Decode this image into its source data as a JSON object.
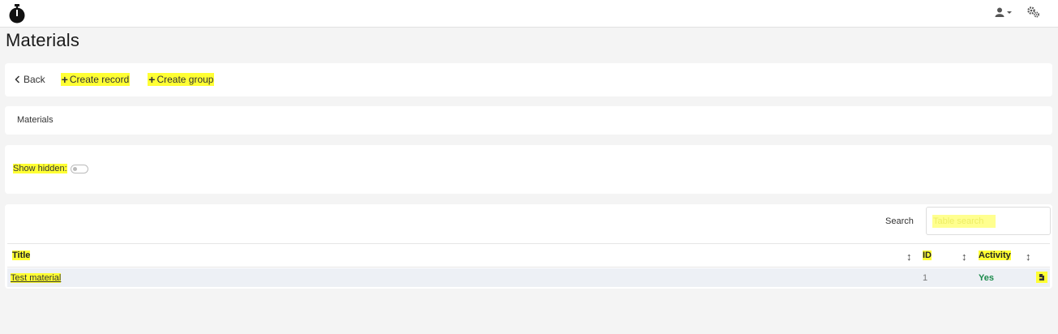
{
  "header": {
    "logo_icon": "stopwatch-icon",
    "user_icon": "user-icon",
    "settings_icon": "gears-icon"
  },
  "page": {
    "title": "Materials"
  },
  "actions": {
    "back_label": "Back",
    "create_record_label": "Create record",
    "create_group_label": "Create group"
  },
  "breadcrumb": {
    "label": "Materials"
  },
  "filters": {
    "show_hidden_label": "Show hidden:",
    "show_hidden_on": false
  },
  "table": {
    "search_label": "Search",
    "search_placeholder": "Table search",
    "columns": [
      "Title",
      "ID",
      "Activity"
    ],
    "rows": [
      {
        "title": "Test material",
        "id": "1",
        "activity": "Yes"
      }
    ]
  },
  "colors": {
    "highlight": "#ffff33",
    "activity_yes": "#1b8a4a",
    "row_bg": "#edf0f5"
  }
}
